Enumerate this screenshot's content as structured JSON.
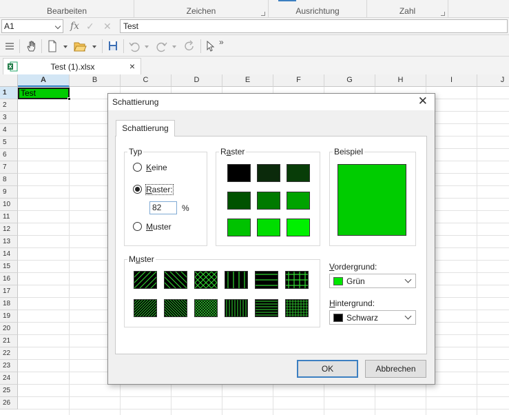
{
  "ribbon": {
    "groups": [
      "Bearbeiten",
      "Zeichen",
      "Ausrichtung",
      "Zahl"
    ]
  },
  "formula_bar": {
    "cell_ref": "A1",
    "fx_label": "fx",
    "content": "Test"
  },
  "document_tab": {
    "title": "Test (1).xlsx",
    "close": "×"
  },
  "sheet": {
    "columns": [
      "A",
      "B",
      "C",
      "D",
      "E",
      "F",
      "G",
      "H",
      "I",
      "J"
    ],
    "rows": [
      "1",
      "2",
      "3",
      "4",
      "5",
      "6",
      "7",
      "8",
      "9",
      "10",
      "11",
      "12",
      "13",
      "14",
      "15",
      "16",
      "17",
      "18",
      "19",
      "20",
      "21",
      "22",
      "23",
      "24",
      "25",
      "26"
    ],
    "selected_cell": "A1",
    "a1_value": "Test",
    "a1_fill": "#00cc00"
  },
  "dialog": {
    "title": "Schattierung",
    "close": "✕",
    "tab": "Schattierung",
    "typ": {
      "label": "Typ",
      "options": [
        {
          "label_u": "K",
          "label_rest": "eine",
          "selected": false
        },
        {
          "label_u": "R",
          "label_rest": "aster:",
          "selected": true
        },
        {
          "label_u": "M",
          "label_rest": "uster",
          "selected": false
        }
      ],
      "percent_value": "82",
      "percent_unit": "%"
    },
    "raster": {
      "label_pre": "R",
      "label_u": "a",
      "label_post": "ster",
      "swatches": [
        "#000000",
        "#0b2a0b",
        "#083d08",
        "#005200",
        "#007a00",
        "#00a300",
        "#00c200",
        "#00dd00",
        "#00f000"
      ]
    },
    "beispiel": {
      "label": "Beispiel",
      "color": "#00cc00"
    },
    "muster": {
      "label_u": "u",
      "label_pre": "M",
      "label_post": "ster",
      "fg_color": "#33dd33",
      "patterns": [
        "diag-down-wide",
        "diag-up-wide",
        "cross-diag-wide",
        "vertical-wide",
        "horizontal-wide",
        "grid-wide",
        "diag-down-fine",
        "diag-up-fine",
        "cross-diag-fine",
        "vertical-fine",
        "horizontal-fine",
        "grid-fine"
      ]
    },
    "vordergrund": {
      "label_u": "V",
      "label_rest": "ordergrund:",
      "value": "Grün",
      "color": "#00e600"
    },
    "hintergrund": {
      "label_u": "H",
      "label_rest": "intergrund:",
      "value": "Schwarz",
      "color": "#000000"
    },
    "ok": "OK",
    "cancel": "Abbrechen"
  }
}
